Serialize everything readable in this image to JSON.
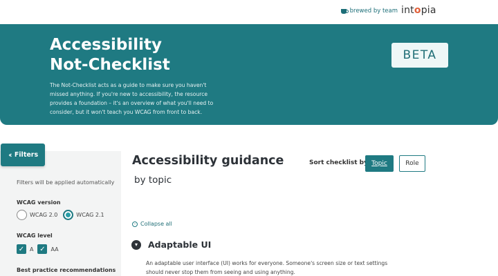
{
  "brand": {
    "brewed_text": "brewed by team",
    "logo_prefix": "int",
    "logo_o": "o",
    "logo_suffix": "pia"
  },
  "hero": {
    "title_line1": "Accessibility",
    "title_line2": "Not-Checklist",
    "description": "The Not-Checklist acts as a guide to make sure you haven't missed anything. If you're new to accessibility, the resource provides a foundation – it's an overview of what you'll need to consider, but it won't teach you WCAG from front to back.",
    "badge": "BETA"
  },
  "filters": {
    "button_label": "Filters",
    "auto_note": "Filters will be applied automatically",
    "wcag_version_label": "WCAG version",
    "wcag_versions": [
      "WCAG 2.0",
      "WCAG 2.1"
    ],
    "wcag_version_selected": "WCAG 2.1",
    "wcag_level_label": "WCAG level",
    "wcag_levels": [
      "A",
      "AA"
    ],
    "best_practice_label": "Best practice recommendations"
  },
  "main": {
    "title": "Accessibility guidance",
    "subtitle": "by topic",
    "sort_label": "Sort checklist by",
    "sort_options": [
      "Topic",
      "Role"
    ],
    "sort_selected": "Topic",
    "collapse_all": "Collapse all",
    "section_title": "Adaptable UI",
    "section_desc": "An adaptable user interface (UI) works for everyone. Someone's screen size or text settings should never stop them from seeing and using anything."
  },
  "colors": {
    "teal": "#1f7a82",
    "accent_orange": "#e1603a"
  },
  "icons": {
    "cup": "coffee-cup-icon",
    "filters": "double-chevron-left-icon",
    "collapse": "minus-circle-icon",
    "section": "chevron-down-icon"
  }
}
